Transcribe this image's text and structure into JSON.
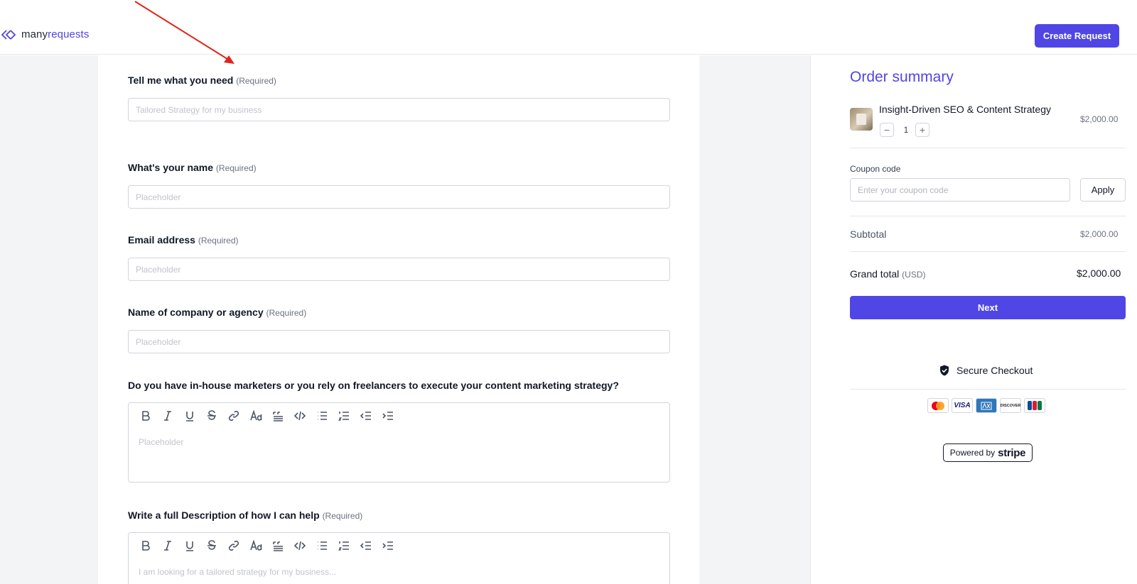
{
  "header": {
    "logo_part1": "many",
    "logo_part2": "requests",
    "create_button": "Create Request"
  },
  "form": {
    "required_tag": "(Required)",
    "fields": [
      {
        "label": "Tell me what you need",
        "placeholder": "Tailored Strategy for my business"
      },
      {
        "label": "What's your name",
        "placeholder": "Placeholder"
      },
      {
        "label": "Email address",
        "placeholder": "Placeholder"
      },
      {
        "label": "Name of company or agency",
        "placeholder": "Placeholder"
      }
    ],
    "editors": [
      {
        "label": "Do you have in-house marketers or you rely on freelancers to execute your content marketing strategy?",
        "placeholder": "Placeholder"
      },
      {
        "label": "Write a full Description of how I can help",
        "placeholder": "I am looking for a tailored strategy for my business..."
      }
    ]
  },
  "summary": {
    "title": "Order summary",
    "product": {
      "name": "Insight-Driven SEO & Content Strategy",
      "price": "$2,000.00",
      "quantity": "1",
      "minus": "−",
      "plus": "+"
    },
    "coupon": {
      "label": "Coupon code",
      "placeholder": "Enter your coupon code",
      "apply": "Apply"
    },
    "subtotal_label": "Subtotal",
    "subtotal_value": "$2,000.00",
    "grand_label": "Grand total",
    "grand_currency": "(USD)",
    "grand_value": "$2,000.00",
    "next_button": "Next",
    "secure_text": "Secure Checkout",
    "cards": [
      "mastercard",
      "VISA",
      "amex",
      "DISCOVER",
      "JCB"
    ],
    "powered_by": "Powered by",
    "powered_brand": "stripe"
  },
  "colors": {
    "accent": "#4f46e5",
    "annotation_arrow": "#e0251b"
  }
}
